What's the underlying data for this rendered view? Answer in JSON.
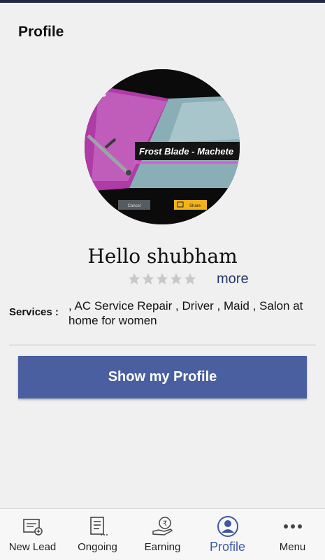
{
  "header": {
    "title": "Profile"
  },
  "profile": {
    "greeting": "Hello shubham",
    "rating": {
      "value": 0,
      "max": 5
    },
    "more_label": "more",
    "services_label": "Services :",
    "services_value": ", AC Service Repair , Driver , Maid , Salon at home for women",
    "show_profile_button": "Show my Profile",
    "avatar_image_text": {
      "banner": "Frost Blade - Machete",
      "left_button": "Cancel",
      "right_button": "Share"
    }
  },
  "colors": {
    "accent": "#4a5f9f",
    "active_tab": "#3f58a0",
    "star_empty": "#c8c8c8"
  },
  "bottom_nav": {
    "items": [
      {
        "label": "New Lead",
        "icon": "new-lead-icon"
      },
      {
        "label": "Ongoing",
        "icon": "ongoing-list-icon"
      },
      {
        "label": "Earning",
        "icon": "rupee-earning-icon"
      },
      {
        "label": "Profile",
        "icon": "profile-user-icon",
        "active": true
      },
      {
        "label": "Menu",
        "icon": "more-dots-icon"
      }
    ]
  }
}
